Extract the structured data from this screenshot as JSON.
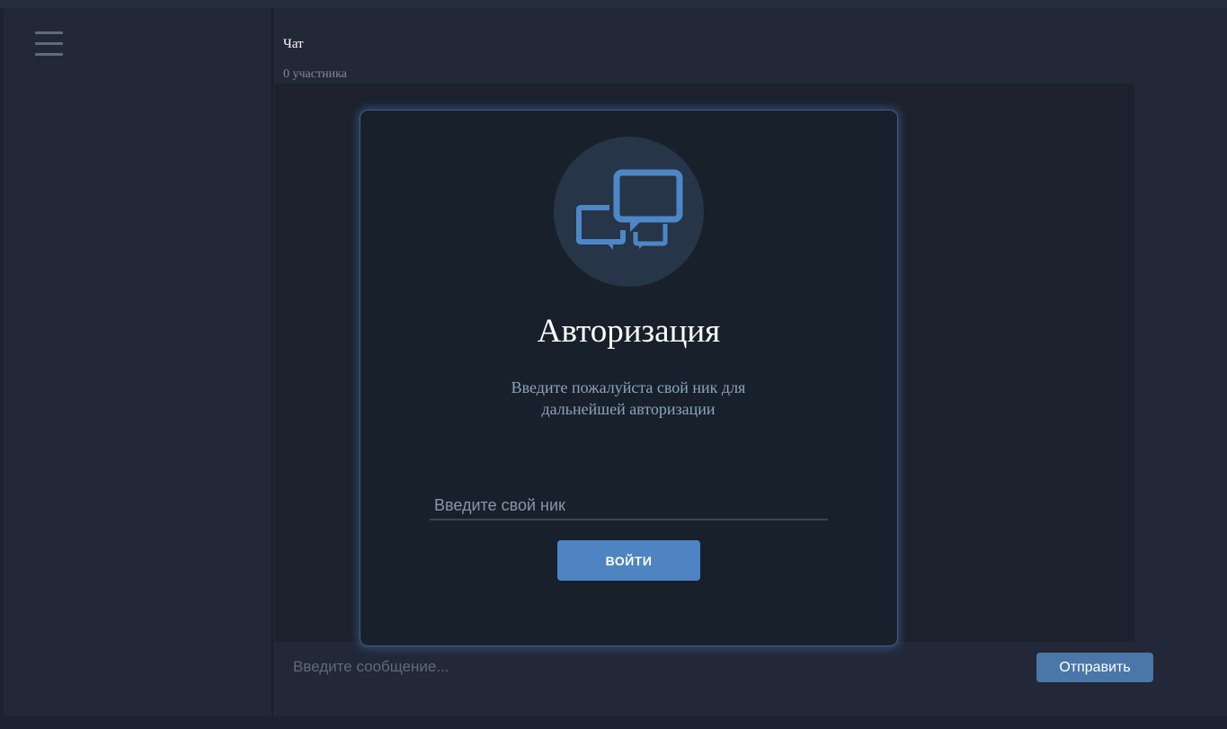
{
  "header": {
    "title": "Чат",
    "participants": "0 участника"
  },
  "sidebar": {
    "menu_icon": "hamburger-menu-icon"
  },
  "auth_modal": {
    "logo_icon": "chat-bubbles-icon",
    "title": "Авторизация",
    "description": "Введите пожалуйста свой ник для дальнейшей авторизации",
    "nick_placeholder": "Введите свой ник",
    "nick_value": "",
    "login_label": "ВОЙТИ"
  },
  "composer": {
    "message_placeholder": "Введите сообщение...",
    "message_value": "",
    "send_label": "Отправить"
  },
  "colors": {
    "accent": "#4f84c2",
    "send_button": "#4a76a8",
    "background": "#222838",
    "modal_background": "#18202b",
    "modal_glow": "#4e82c8"
  }
}
